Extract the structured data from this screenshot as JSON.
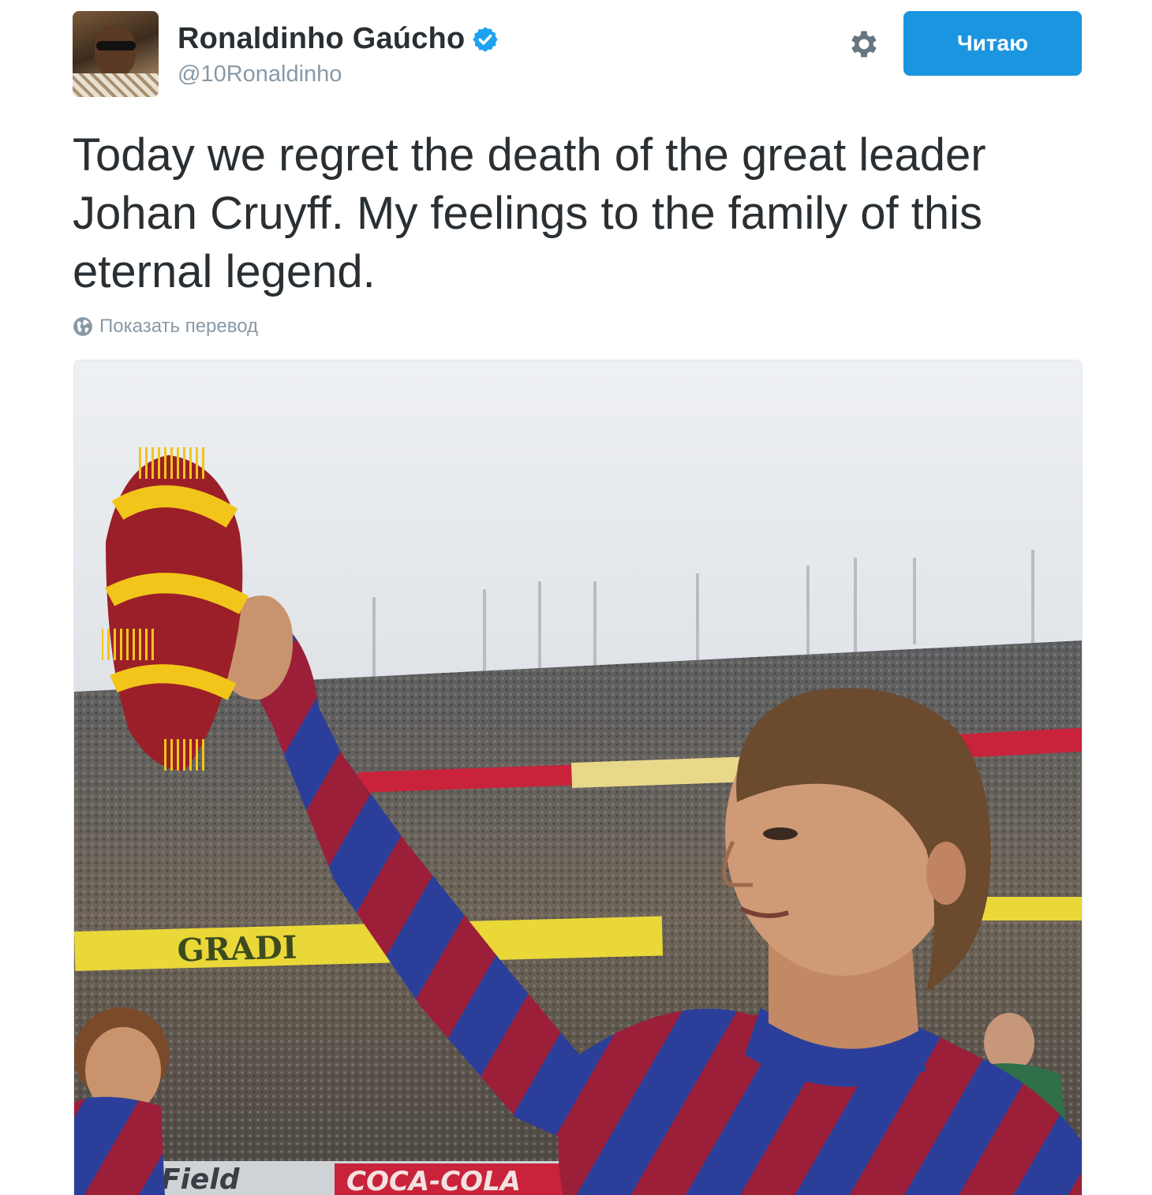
{
  "tweet": {
    "display_name": "Ronaldinho Gaúcho",
    "handle": "@10Ronaldinho",
    "verified": true,
    "follow_button_label": "Читаю",
    "text": "Today we regret the death of the great leader Johan Cruyff. My feelings to the family of this eternal legend.",
    "translate_link": "Показать перевод"
  },
  "photo": {
    "banner_text_left": "GRADI",
    "banner_text_right": "COCA-COLA",
    "banner_text_bottom": "Field"
  },
  "icons": {
    "avatar": "avatar-photo",
    "verified": "verified-badge-icon",
    "settings": "gear-icon",
    "translate": "globe-icon"
  },
  "colors": {
    "accent": "#1b95e0",
    "text": "#292f33",
    "muted": "#8899a6"
  }
}
